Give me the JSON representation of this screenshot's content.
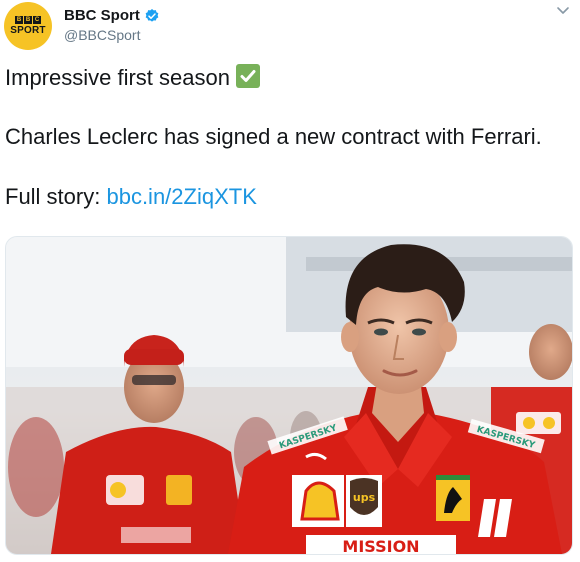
{
  "account": {
    "logo_top": [
      "B",
      "B",
      "C"
    ],
    "logo_bottom": "SPORT",
    "display_name": "BBC Sport",
    "handle": "@BBCSport"
  },
  "tweet": {
    "line1": "Impressive first season",
    "line2": "Charles Leclerc has signed a new contract with Ferrari.",
    "line3_prefix": "Full story: ",
    "link": "bbc.in/2ZiqXTK"
  },
  "media": {
    "image_text": {
      "left_sponsor": "KASPERSKY",
      "right_sponsor": "KASPERSKY",
      "ups": "ups",
      "bottom": "MISSION"
    }
  },
  "colors": {
    "logo_bg": "#f6c325",
    "link": "#1b95e0",
    "ferrari_red": "#d81e15",
    "check_green": "#78b159"
  },
  "icons": [
    "verified-badge-icon",
    "caret-down-icon",
    "checkmark-emoji-icon"
  ]
}
